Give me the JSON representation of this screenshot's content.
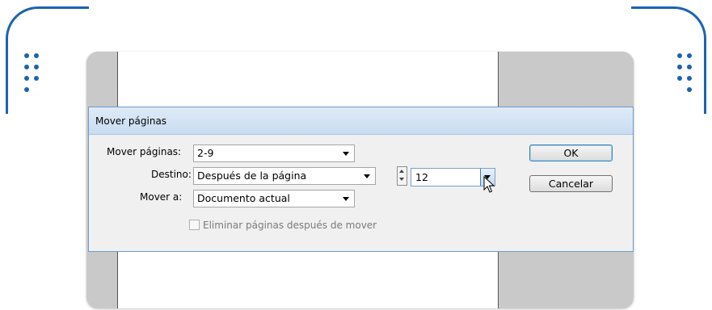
{
  "dialog": {
    "title": "Mover páginas",
    "fields": {
      "move_pages_label": "Mover páginas:",
      "move_pages_value": "2-9",
      "destination_label": "Destino:",
      "destination_value": "Después de la página",
      "page_number_value": "12",
      "move_to_label": "Mover a:",
      "move_to_value": "Documento actual"
    },
    "checkbox": {
      "label": "Eliminar páginas después de mover",
      "checked": false,
      "enabled": false
    },
    "buttons": {
      "ok_label": "OK",
      "cancel_label": "Cancelar"
    }
  },
  "colors": {
    "frame_accent": "#1c63b0",
    "titlebar": "#c9dcf1",
    "dialog_bg": "#f0f0f0"
  },
  "icons": [
    "spinner-icon",
    "dropdown-arrow-icon",
    "mouse-cursor-icon"
  ]
}
